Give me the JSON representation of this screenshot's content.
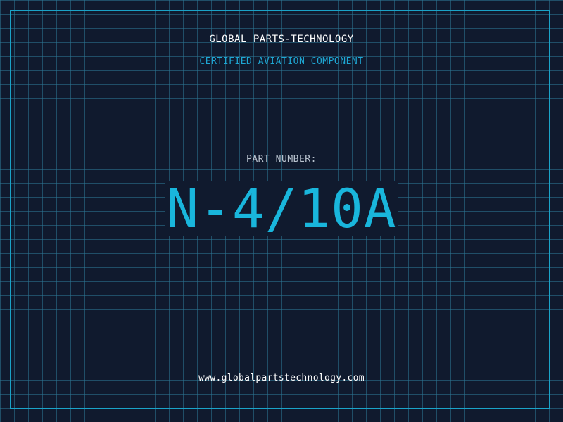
{
  "header": {
    "company": "GLOBAL PARTS-TECHNOLOGY",
    "subtitle": "CERTIFIED AVIATION COMPONENT"
  },
  "part": {
    "label": "PART NUMBER:",
    "number": "N-4/10A"
  },
  "footer": {
    "url": "www.globalpartstechnology.com"
  },
  "colors": {
    "background": "#101a2e",
    "grid": "#2d7896",
    "frame": "#1aa3c8",
    "accent": "#19b6dc",
    "label": "#b9c3cf",
    "text": "#ffffff"
  }
}
